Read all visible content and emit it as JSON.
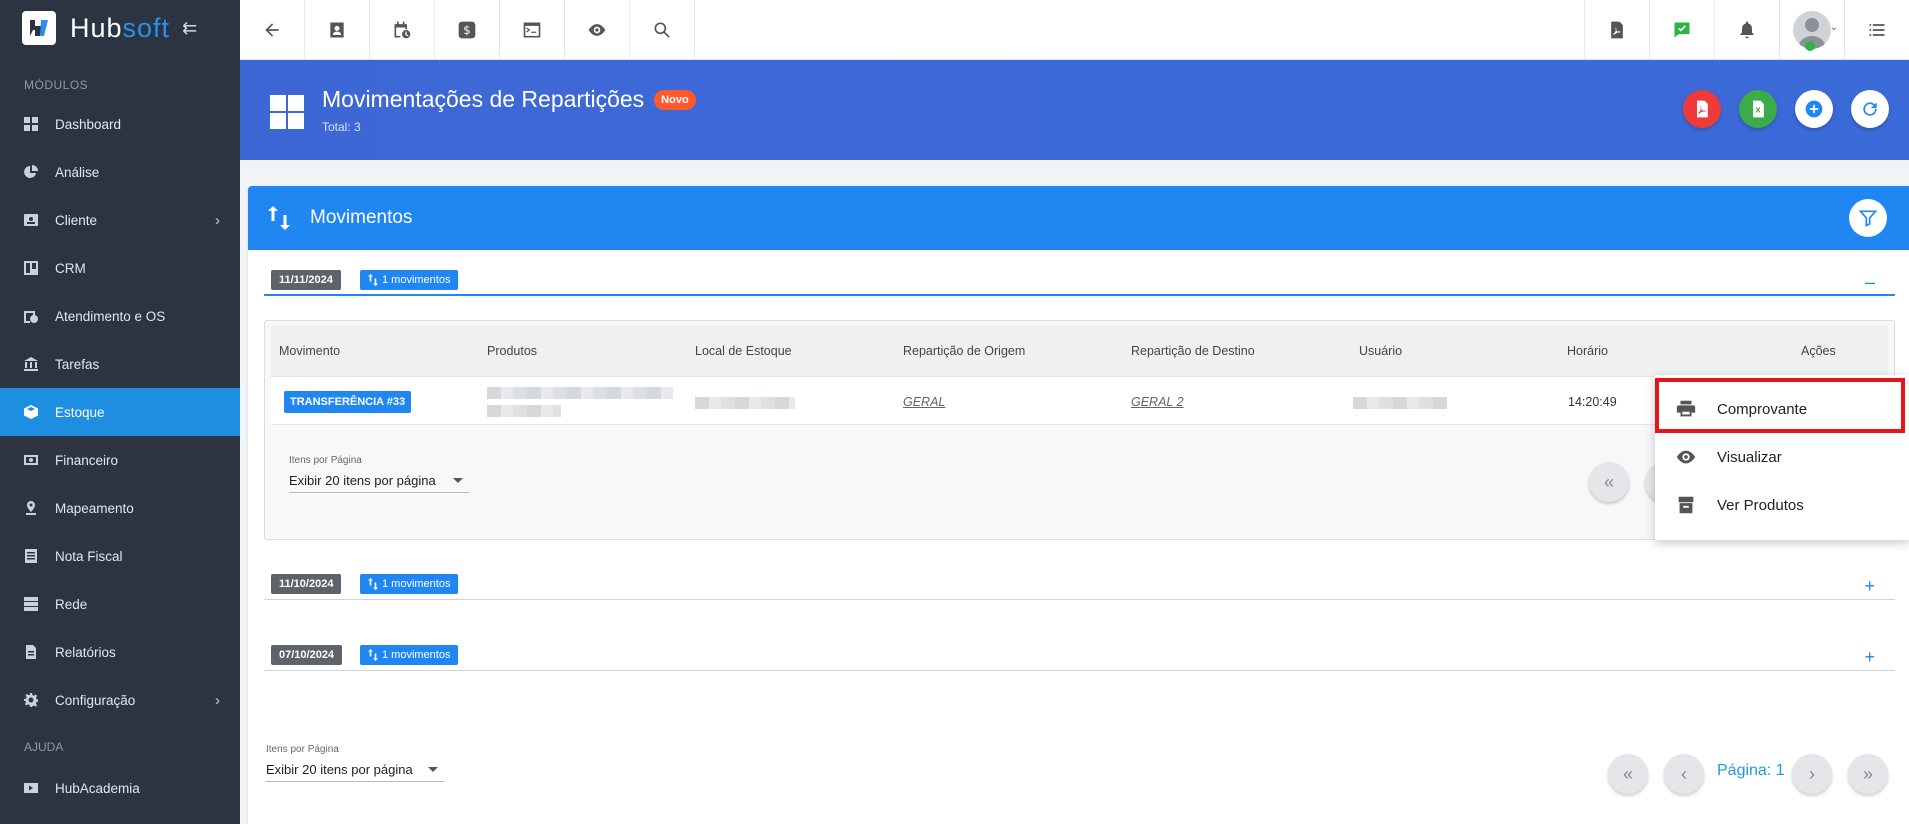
{
  "brand": {
    "name_part1": "Hub",
    "name_part2": "soft",
    "colors": {
      "hub": "#ffffff",
      "soft": "#2a8ff0"
    }
  },
  "sidebar": {
    "section_modules": "MÓDULOS",
    "items": [
      {
        "label": "Dashboard",
        "icon": "dashboard-icon"
      },
      {
        "label": "Análise",
        "icon": "pie-chart-icon"
      },
      {
        "label": "Cliente",
        "icon": "contact-card-icon",
        "has_submenu": true
      },
      {
        "label": "CRM",
        "icon": "board-icon"
      },
      {
        "label": "Atendimento e OS",
        "icon": "calendar-clock-icon"
      },
      {
        "label": "Tarefas",
        "icon": "building-icon"
      },
      {
        "label": "Estoque",
        "icon": "box-icon",
        "active": true
      },
      {
        "label": "Financeiro",
        "icon": "money-icon"
      },
      {
        "label": "Mapeamento",
        "icon": "map-pin-icon"
      },
      {
        "label": "Nota Fiscal",
        "icon": "document-icon"
      },
      {
        "label": "Rede",
        "icon": "server-icon"
      },
      {
        "label": "Relatórios",
        "icon": "report-icon"
      },
      {
        "label": "Configuração",
        "icon": "gear-icon",
        "has_submenu": true
      }
    ],
    "section_help": "AJUDA",
    "help_items": [
      {
        "label": "HubAcademia",
        "icon": "play-icon"
      }
    ]
  },
  "page": {
    "title": "Movimentações de Repartições",
    "badge": "Novo",
    "total": "Total: 3"
  },
  "card": {
    "title": "Movimentos",
    "groups": [
      {
        "date": "11/11/2024",
        "count_label": "1 movimentos",
        "expanded": true
      },
      {
        "date": "11/10/2024",
        "count_label": "1 movimentos",
        "expanded": false
      },
      {
        "date": "07/10/2024",
        "count_label": "1 movimentos",
        "expanded": false
      }
    ],
    "table": {
      "headers": [
        "Movimento",
        "Produtos",
        "Local de Estoque",
        "Repartição de Origem",
        "Repartição de Destino",
        "Usuário",
        "Horário",
        "Ações"
      ],
      "rows": [
        {
          "movimento": "TRANSFERÊNCIA #33",
          "origem": "GERAL",
          "destino": "GERAL 2",
          "horario": "14:20:49"
        }
      ]
    },
    "items_per_page_label": "Itens por Página",
    "items_per_page_value": "Exibir 20 itens por página",
    "page_label": "Página: 1"
  },
  "dropdown": {
    "items": [
      {
        "label": "Comprovante",
        "icon": "printer-icon"
      },
      {
        "label": "Visualizar",
        "icon": "eye-icon"
      },
      {
        "label": "Ver Produtos",
        "icon": "inventory-icon"
      }
    ]
  },
  "colors": {
    "accent": "#1f86f2",
    "sidebar_bg": "#2b3440",
    "header_bg": "#3e67d6",
    "badge_new": "#ff5a2c",
    "highlight": "#e5141b"
  }
}
